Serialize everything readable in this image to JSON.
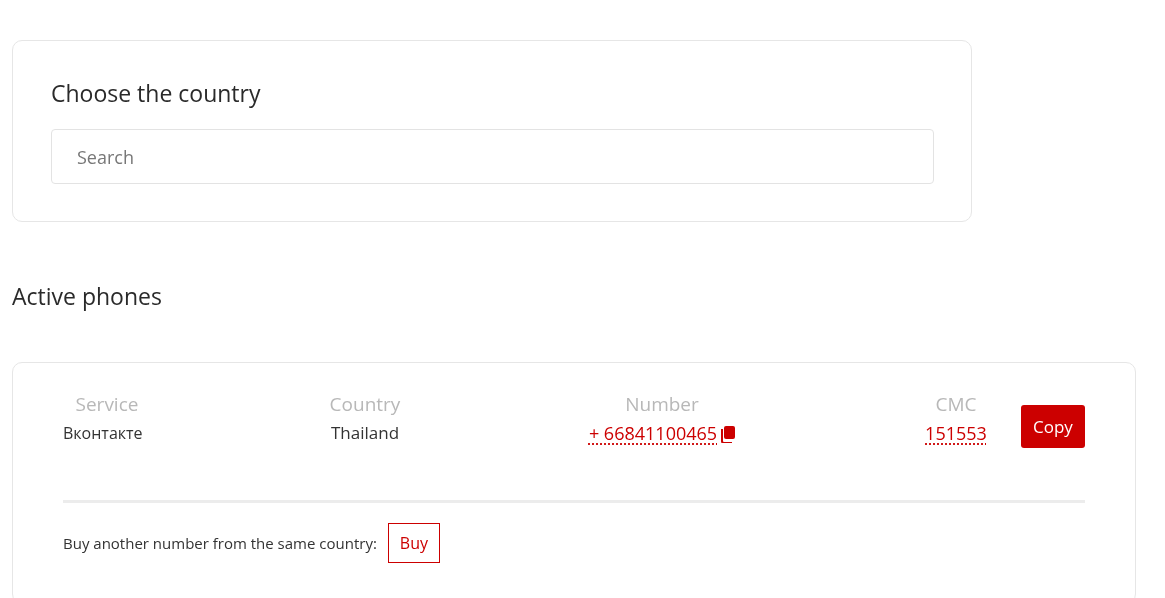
{
  "country_panel": {
    "title": "Choose the country",
    "search": {
      "placeholder": "Search"
    }
  },
  "active_phones": {
    "title": "Active phones",
    "columns": [
      "Service",
      "Country",
      "Number",
      "CMC"
    ],
    "rows": [
      {
        "service": "Вконтакте",
        "country": "Thailand",
        "number": "+ 66841100465",
        "code": "151553",
        "copy_button": "Copy"
      }
    ],
    "footer": {
      "text": "Buy another number from the same country:",
      "button": "Buy"
    }
  }
}
